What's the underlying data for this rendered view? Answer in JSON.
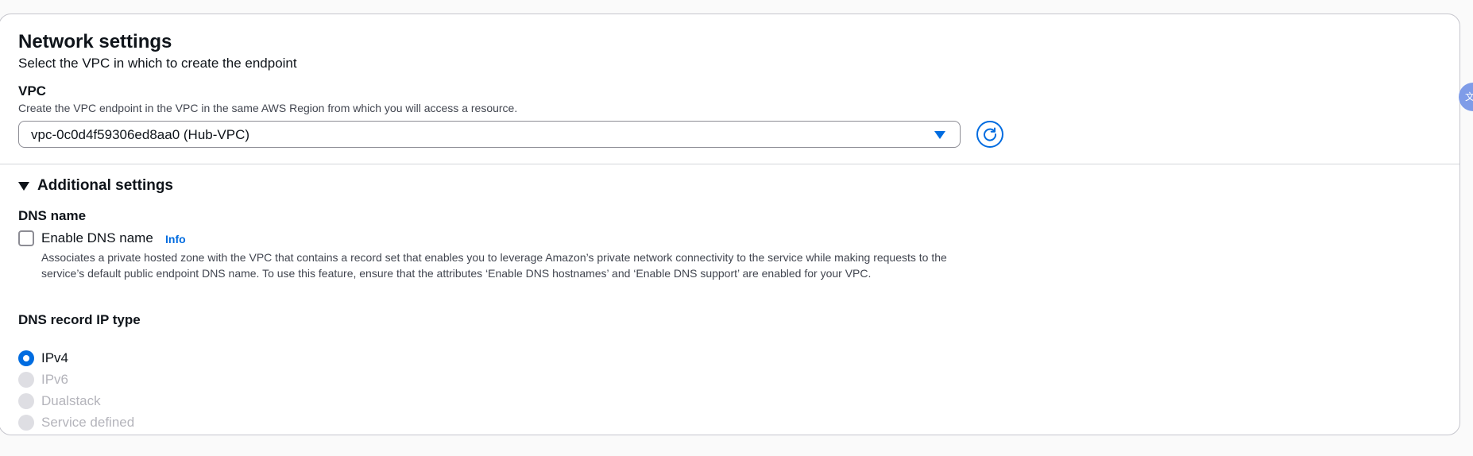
{
  "network": {
    "title": "Network settings",
    "description": "Select the VPC in which to create the endpoint"
  },
  "vpc": {
    "label": "VPC",
    "description": "Create the VPC endpoint in the VPC in the same AWS Region from which you will access a resource.",
    "selected": "vpc-0c0d4f59306ed8aa0 (Hub-VPC)"
  },
  "additional": {
    "label": "Additional settings",
    "expanded": true
  },
  "dns_name": {
    "label": "DNS name",
    "checkbox_label": "Enable DNS name",
    "checked": false,
    "info": "Info",
    "description": "Associates a private hosted zone with the VPC that contains a record set that enables you to leverage Amazon’s private network connectivity to the service while making requests to the service’s default public endpoint DNS name. To use this feature, ensure that the attributes ‘Enable DNS hostnames’ and ‘Enable DNS support’ are enabled for your VPC."
  },
  "dns_record": {
    "label": "DNS record IP type",
    "options": [
      {
        "label": "IPv4",
        "selected": true,
        "disabled": false
      },
      {
        "label": "IPv6",
        "selected": false,
        "disabled": true
      },
      {
        "label": "Dualstack",
        "selected": false,
        "disabled": true
      },
      {
        "label": "Service defined",
        "selected": false,
        "disabled": true
      }
    ]
  },
  "side_badge": {
    "glyph": "文"
  },
  "colors": {
    "accent": "#006ce0",
    "border": "#c6c6cd",
    "disabled_text": "#b4b4bb"
  }
}
